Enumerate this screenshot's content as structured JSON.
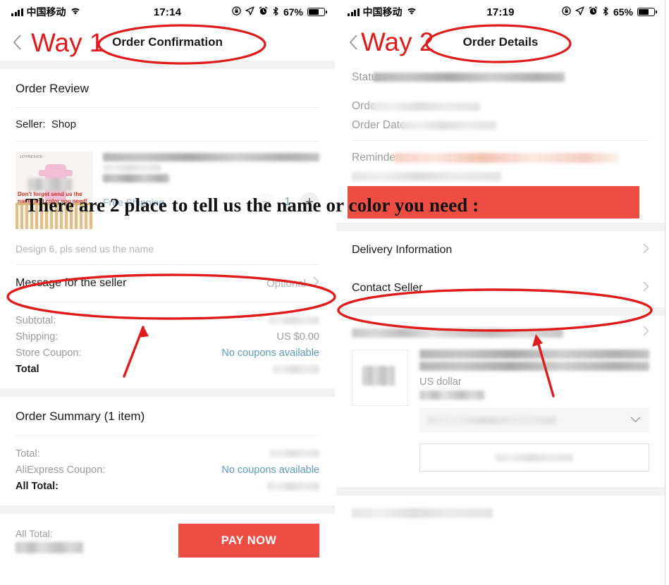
{
  "annotations": {
    "way1_label": "Way 1",
    "way2_label": "Way 2",
    "banner_text": "There are 2 place to tell us the name or color you need :",
    "accent_color": "#e01b1b",
    "banner_highlight_color": "#ee4d43"
  },
  "left_phone": {
    "status_bar": {
      "carrier": "中国移动",
      "time": "17:14",
      "battery_percent": "67%",
      "icons": [
        "signal-bars-icon",
        "wifi-icon",
        "lock-rotation-icon",
        "location-arrow-icon",
        "alarm-clock-icon",
        "bluetooth-icon",
        "battery-icon"
      ]
    },
    "nav": {
      "title": "Order Confirmation",
      "back_icon": "chevron-left-icon"
    },
    "order_review": {
      "section_title": "Order Review",
      "seller_label": "Seller:",
      "seller_name": "Shop",
      "product": {
        "thumb_brand": "JOYRESIDE",
        "thumb_caption": "Don't forget send us the name and color you need!",
        "free_shipping": "Free Shipping",
        "quantity": "1",
        "minus_icon": "minus-icon",
        "plus_icon": "plus-icon"
      },
      "buyer_note": "Design 6, pls send us the name"
    },
    "message_row": {
      "label": "Message for the seller",
      "value": "Optional",
      "chevron_icon": "chevron-right-icon"
    },
    "price_breakdown": [
      {
        "label": "Subtotal:",
        "value": "",
        "is_link": false,
        "blurred": true
      },
      {
        "label": "Shipping:",
        "value": "US $0.00",
        "is_link": false,
        "blurred": false
      },
      {
        "label": "Store Coupon:",
        "value": "No coupons available",
        "is_link": true,
        "blurred": false
      },
      {
        "label": "Total",
        "value": "",
        "is_link": false,
        "blurred": true,
        "strong": true
      }
    ],
    "order_summary": {
      "section_title": "Order Summary (1 item)",
      "rows": [
        {
          "label": "Total:",
          "value": "",
          "is_link": false,
          "blurred": true
        },
        {
          "label": "AliExpress Coupon:",
          "value": "No coupons available",
          "is_link": true,
          "blurred": false
        },
        {
          "label": "All Total:",
          "value": "",
          "is_link": false,
          "blurred": true,
          "strong": true
        }
      ]
    },
    "pay_bar": {
      "all_total_label": "All Total:",
      "pay_button": "PAY NOW",
      "pay_button_color": "#ee4d43"
    }
  },
  "right_phone": {
    "status_bar": {
      "carrier": "中国移动",
      "time": "17:19",
      "battery_percent": "65%",
      "icons": [
        "signal-bars-icon",
        "wifi-icon",
        "lock-rotation-icon",
        "location-arrow-icon",
        "alarm-clock-icon",
        "bluetooth-icon",
        "battery-icon"
      ]
    },
    "nav": {
      "title": "Order Details",
      "back_icon": "chevron-left-icon"
    },
    "details": [
      {
        "label": "Status:",
        "blurred": true
      },
      {
        "label": "Orde",
        "blurred": true
      },
      {
        "label": "Order Date",
        "blurred": true
      },
      {
        "label": "Reminder:",
        "blurred": true,
        "peach": true
      }
    ],
    "links": [
      {
        "label": "Delivery Information",
        "chevron_icon": "chevron-right-icon"
      },
      {
        "label": "Contact Seller",
        "chevron_icon": "chevron-right-icon"
      }
    ],
    "item": {
      "currency_note": "US dollar",
      "select_chevron_icon": "chevron-down-icon"
    }
  }
}
